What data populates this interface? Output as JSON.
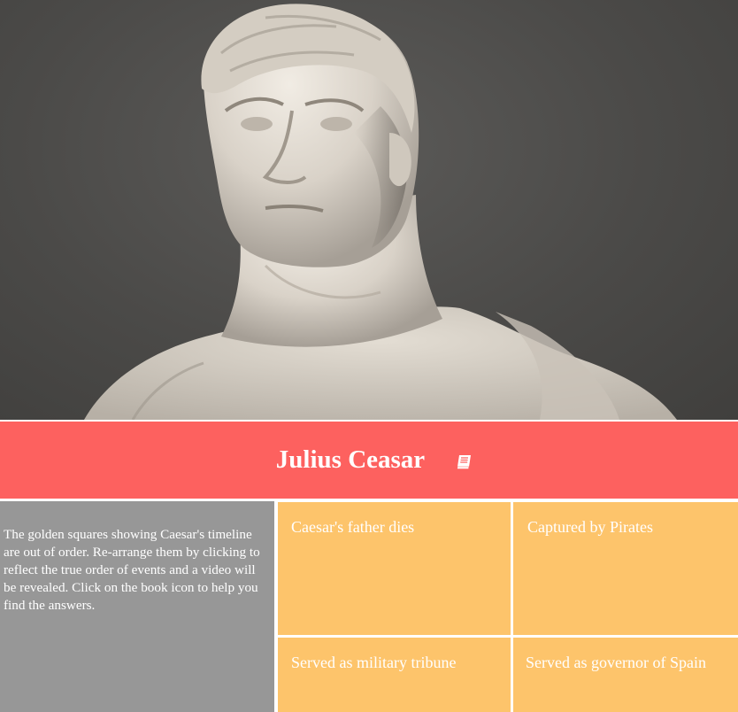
{
  "hero": {
    "image": "marble-bust-of-julius-caesar"
  },
  "header": {
    "title": "Julius Ceasar",
    "book_icon": "book-icon"
  },
  "instructions": {
    "text": "The golden squares showing Caesar's timeline are out of order. Re-arrange them by clicking to reflect the true order of events and a video will be revealed. Click on the book icon to help you find the answers."
  },
  "timeline_tiles": [
    {
      "label": "Caesar's father dies"
    },
    {
      "label": "Captured by Pirates"
    },
    {
      "label": "Served as military tribune"
    },
    {
      "label": "Served as governor of Spain"
    }
  ],
  "colors": {
    "title_bar": "#fd615f",
    "instructions_panel": "#979797",
    "tile": "#fdc46b",
    "hero_background": "#4b4a48"
  }
}
